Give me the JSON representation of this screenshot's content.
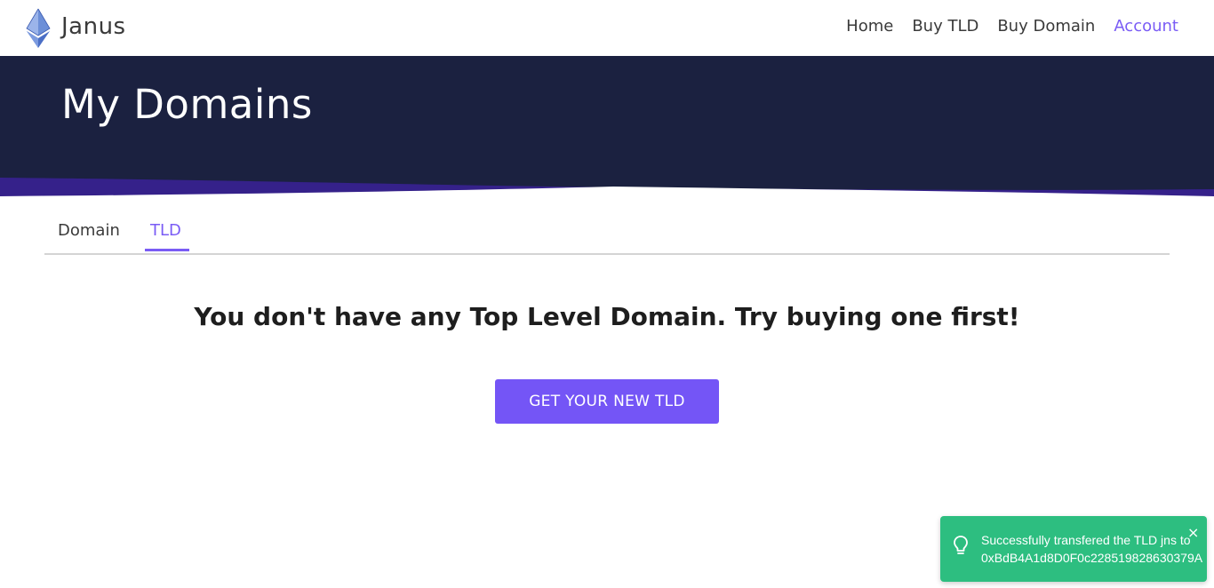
{
  "navbar": {
    "brand": "Janus",
    "logo_icon": "ethereum-diamond-icon",
    "links": [
      {
        "label": "Home",
        "active": false
      },
      {
        "label": "Buy TLD",
        "active": false
      },
      {
        "label": "Buy Domain",
        "active": false
      },
      {
        "label": "Account",
        "active": true
      }
    ]
  },
  "hero": {
    "title": "My Domains"
  },
  "tabs": [
    {
      "label": "Domain",
      "active": false
    },
    {
      "label": "TLD",
      "active": true
    }
  ],
  "main": {
    "empty_message": "You don't have any Top Level Domain. Try buying one first!",
    "cta_label": "GET YOUR NEW TLD"
  },
  "toast": {
    "icon": "lightbulb-icon",
    "message_line1": "Successfully transfered the TLD jns to",
    "message_line2": "0xBdB4A1d8D0F0c228519828630379A",
    "close_glyph": "×"
  },
  "colors": {
    "accent": "#7a5cf5",
    "button": "#7455f6",
    "hero_background": "#1b2140",
    "hero_wave": "#35218a",
    "toast_success": "#2dbe80"
  }
}
